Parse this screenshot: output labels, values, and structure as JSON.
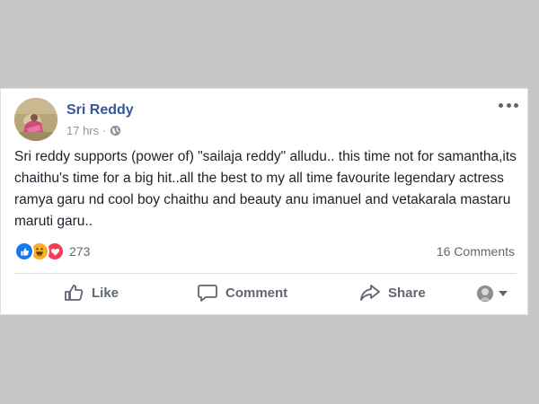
{
  "post": {
    "author": "Sri Reddy",
    "time": "17 hrs",
    "separator": "·",
    "privacy_icon": "globe-icon",
    "text": "Sri reddy supports (power of) \"sailaja reddy\" alludu.. this time not for samantha,its chaithu's time for a big hit..all the best to my all time favourite legendary actress ramya garu nd cool boy chaithu and beauty anu imanuel and vetakarala mastaru maruti garu..",
    "reaction_count": "273",
    "comments_count": "16 Comments",
    "reaction_icons": [
      "like-icon",
      "haha-icon",
      "love-icon"
    ]
  },
  "actions": {
    "like": "Like",
    "comment": "Comment",
    "share": "Share"
  },
  "colors": {
    "author": "#365899",
    "like_blue": "#1877f2",
    "love_red": "#f33e58",
    "haha_yellow": "#f7b125",
    "text": "#1d2129",
    "muted": "#606770"
  }
}
